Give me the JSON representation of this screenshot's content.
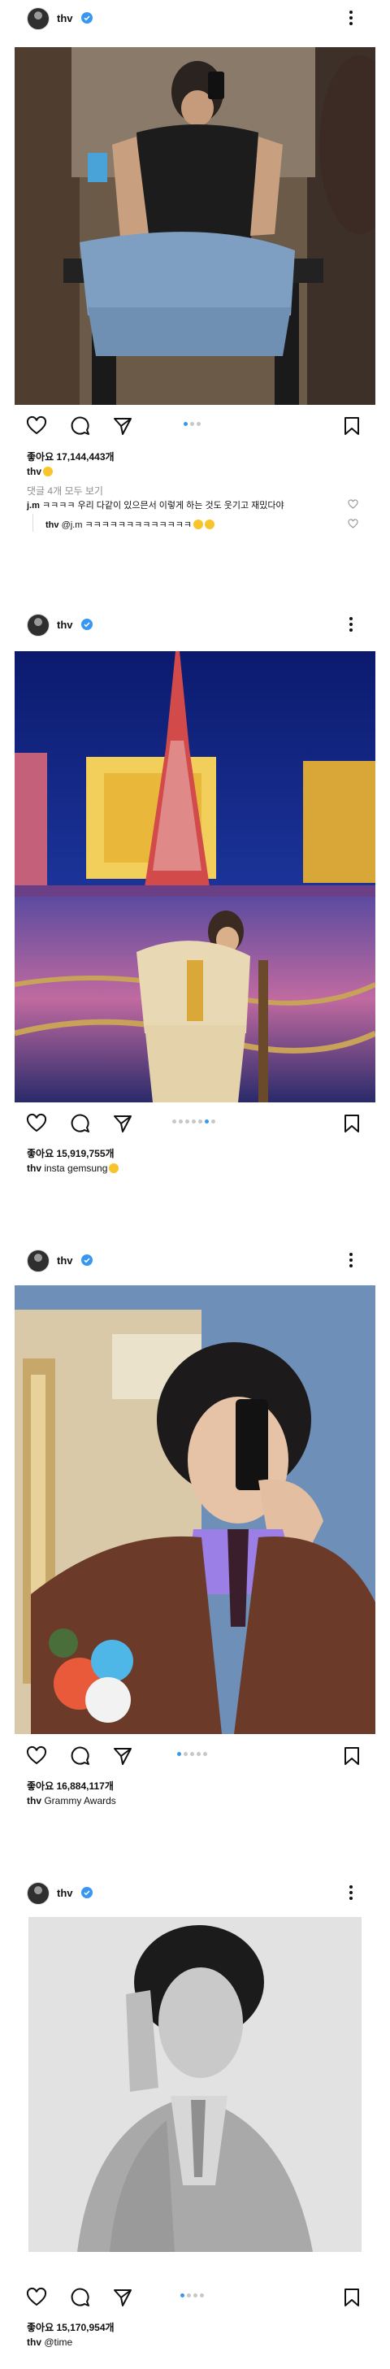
{
  "posts": [
    {
      "username": "thv",
      "likes": "좋아요 17,144,443개",
      "caption_user": "thv",
      "caption_text": "",
      "view_comments": "댓글 4개 모두 보기",
      "comments": [
        {
          "user": "j.m",
          "text": "ㅋㅋㅋㅋ 우리 다같이 있으믄서 이렇게 하는 것도 웃기고 재밌다야"
        },
        {
          "user": "thv",
          "text": "@j.m ㅋㅋㅋㅋㅋㅋㅋㅋㅋㅋㅋㅋㅋ"
        }
      ],
      "carousel": {
        "count": 3,
        "active": 1
      }
    },
    {
      "username": "thv",
      "likes": "좋아요 15,919,755개",
      "caption_user": "thv",
      "caption_text": "insta gemsung",
      "carousel": {
        "count": 7,
        "active": 5
      }
    },
    {
      "username": "thv",
      "likes": "좋아요 16,884,117개",
      "caption_user": "thv",
      "caption_text": "Grammy Awards",
      "carousel": {
        "count": 5,
        "active": 0
      }
    },
    {
      "username": "thv",
      "likes": "좋아요 15,170,954개",
      "caption_user": "thv",
      "caption_text": "@time",
      "carousel": {
        "count": 4,
        "active": 0
      }
    }
  ],
  "colors": {
    "accent": "#3897f0",
    "verified": "#3897f0",
    "muted": "#8e8e8e"
  },
  "icons": [
    "more-vertical-icon",
    "heart-icon",
    "comment-icon",
    "share-icon",
    "bookmark-icon",
    "verified-badge-icon"
  ]
}
